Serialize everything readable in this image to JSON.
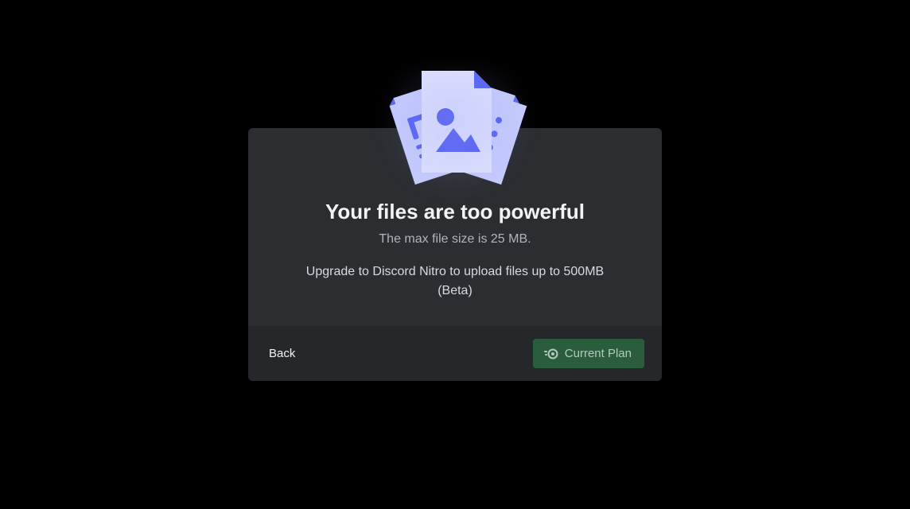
{
  "dialog": {
    "title": "Your files are too powerful",
    "subtitle": "The max file size is 25 MB.",
    "upgrade_text": "Upgrade to Discord Nitro to upload files up to 500MB (Beta)"
  },
  "footer": {
    "back_label": "Back",
    "plan_label": "Current Plan"
  },
  "icons": {
    "illustration": "files-stack-icon",
    "plan_icon": "nitro-icon"
  },
  "colors": {
    "modal_bg": "#2b2d31",
    "footer_bg": "#26272b",
    "text_primary": "#f2f3f5",
    "text_secondary": "#b1b4bb",
    "accent_button_bg": "#2a5c3e",
    "accent_button_text": "#b6c8bc",
    "file_light": "#c5cbfc",
    "file_dark": "#5865f2"
  }
}
